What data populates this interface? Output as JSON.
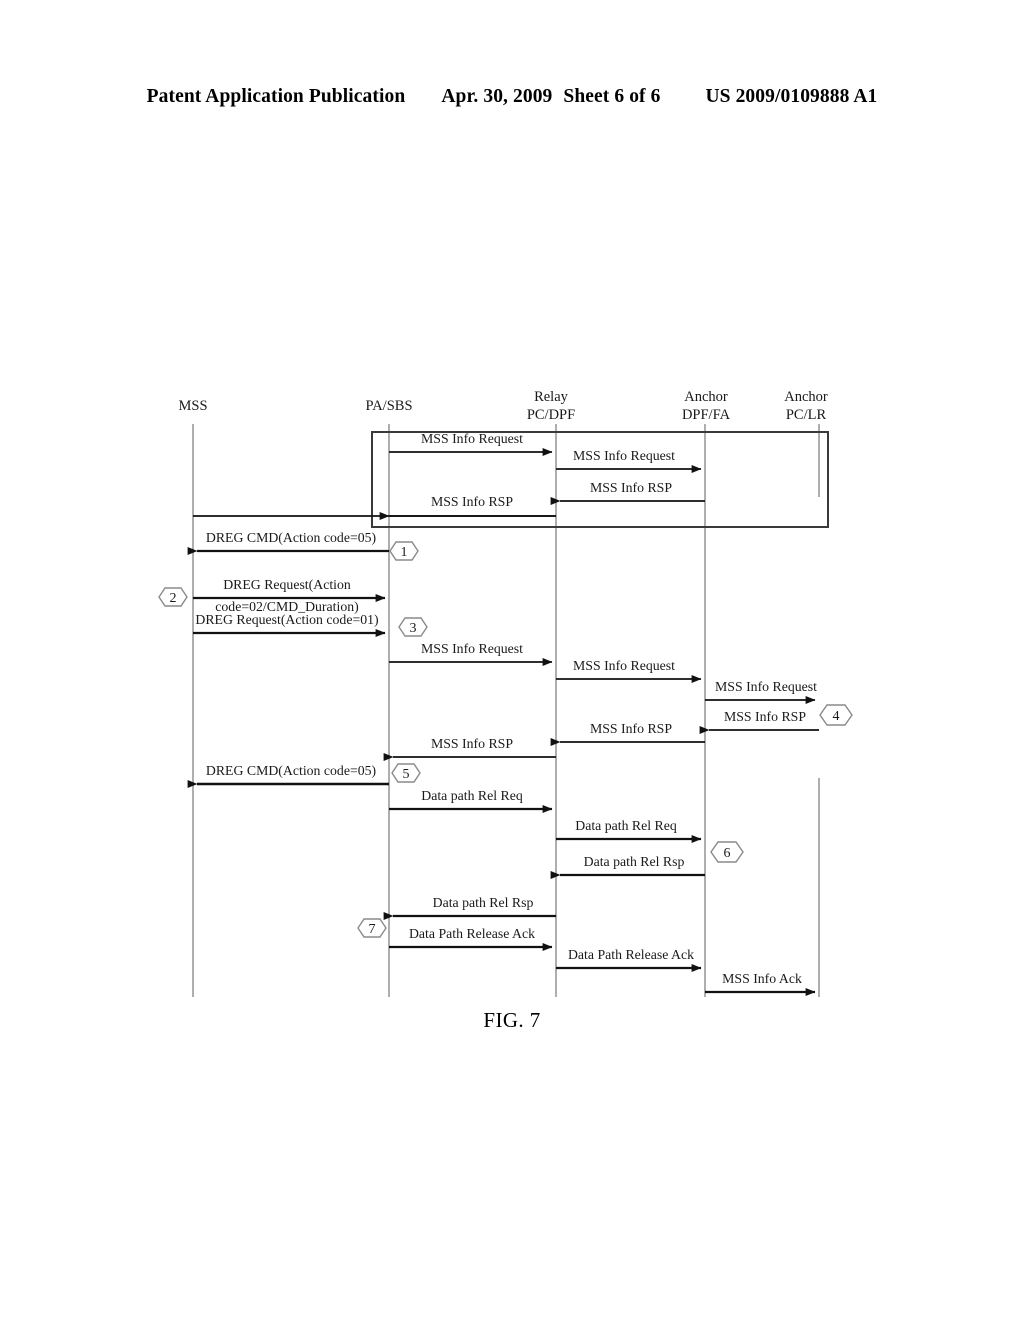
{
  "header": {
    "publication": "Patent Application Publication",
    "date": "Apr. 30, 2009",
    "sheet": "Sheet 6 of 6",
    "patent_number": "US 2009/0109888 A1"
  },
  "figure": {
    "caption": "FIG. 7",
    "lifelines": [
      {
        "id": "mss",
        "label_line1": "MSS",
        "label_line2": ""
      },
      {
        "id": "pa-sbs",
        "label_line1": "PA/SBS",
        "label_line2": ""
      },
      {
        "id": "relay-pc-dpf",
        "label_line1": "Relay",
        "label_line2": "PC/DPF"
      },
      {
        "id": "anchor-dpf-fa",
        "label_line1": "Anchor",
        "label_line2": "DPF/FA"
      },
      {
        "id": "anchor-pc-lr",
        "label_line1": "Anchor",
        "label_line2": "PC/LR"
      }
    ],
    "messages": [
      {
        "id": "m01",
        "label": "MSS Info Request",
        "from": "pa-sbs",
        "to": "relay-pc-dpf"
      },
      {
        "id": "m02",
        "label": "MSS Info Request",
        "from": "relay-pc-dpf",
        "to": "anchor-dpf-fa"
      },
      {
        "id": "m03",
        "label": "MSS Info RSP",
        "from": "anchor-dpf-fa",
        "to": "relay-pc-dpf"
      },
      {
        "id": "m04",
        "label": "MSS Info RSP",
        "from": "relay-pc-dpf",
        "to": "pa-sbs"
      },
      {
        "id": "m05",
        "label": "DREG CMD(Action code=05)",
        "from": "pa-sbs",
        "to": "mss"
      },
      {
        "id": "m06",
        "label_line1": "DREG Request(Action",
        "label_line2": "code=02/CMD_Duration)",
        "from": "mss",
        "to": "pa-sbs"
      },
      {
        "id": "m07",
        "label": "DREG Request(Action code=01)",
        "from": "mss",
        "to": "pa-sbs"
      },
      {
        "id": "m08",
        "label": "MSS Info Request",
        "from": "pa-sbs",
        "to": "relay-pc-dpf"
      },
      {
        "id": "m09",
        "label": "MSS Info Request",
        "from": "relay-pc-dpf",
        "to": "anchor-dpf-fa"
      },
      {
        "id": "m10",
        "label": "MSS Info Request",
        "from": "anchor-dpf-fa",
        "to": "anchor-pc-lr"
      },
      {
        "id": "m11",
        "label": "MSS Info RSP",
        "from": "anchor-pc-lr",
        "to": "anchor-dpf-fa"
      },
      {
        "id": "m12",
        "label": "MSS Info RSP",
        "from": "anchor-dpf-fa",
        "to": "relay-pc-dpf"
      },
      {
        "id": "m13",
        "label": "MSS Info RSP",
        "from": "relay-pc-dpf",
        "to": "pa-sbs"
      },
      {
        "id": "m14",
        "label": "DREG CMD(Action code=05)",
        "from": "pa-sbs",
        "to": "mss"
      },
      {
        "id": "m15",
        "label": "Data path Rel Req",
        "from": "pa-sbs",
        "to": "relay-pc-dpf"
      },
      {
        "id": "m16",
        "label": "Data path Rel Req",
        "from": "relay-pc-dpf",
        "to": "anchor-dpf-fa"
      },
      {
        "id": "m17",
        "label": "Data path Rel Rsp",
        "from": "anchor-dpf-fa",
        "to": "relay-pc-dpf"
      },
      {
        "id": "m18",
        "label": "Data path Rel Rsp",
        "from": "relay-pc-dpf",
        "to": "pa-sbs"
      },
      {
        "id": "m19",
        "label": "Data Path Release Ack",
        "from": "pa-sbs",
        "to": "relay-pc-dpf"
      },
      {
        "id": "m20",
        "label": "Data Path Release Ack",
        "from": "relay-pc-dpf",
        "to": "anchor-dpf-fa"
      },
      {
        "id": "m21",
        "label": "MSS Info Ack",
        "from": "anchor-dpf-fa",
        "to": "anchor-pc-lr"
      }
    ],
    "step_markers": [
      {
        "id": "s1",
        "number": "1"
      },
      {
        "id": "s2",
        "number": "2"
      },
      {
        "id": "s3",
        "number": "3"
      },
      {
        "id": "s4",
        "number": "4"
      },
      {
        "id": "s5",
        "number": "5"
      },
      {
        "id": "s6",
        "number": "6"
      },
      {
        "id": "s7",
        "number": "7"
      }
    ]
  }
}
